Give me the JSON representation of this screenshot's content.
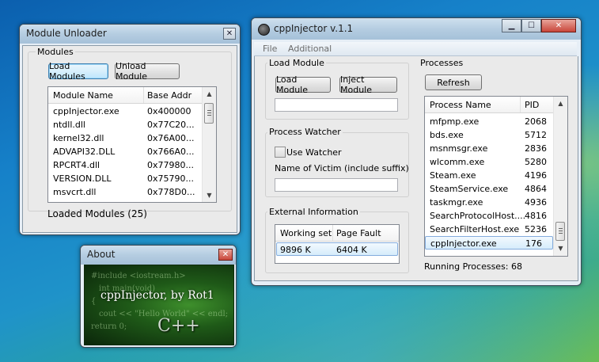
{
  "unloader": {
    "title": "Module Unloader",
    "group_label": "Modules",
    "load_btn": "Load Modules",
    "unload_btn": "Unload Module",
    "columns": [
      "Module Name",
      "Base Addr"
    ],
    "rows": [
      [
        "cppInjector.exe",
        "0x400000"
      ],
      [
        "ntdll.dll",
        "0x77C20..."
      ],
      [
        "kernel32.dll",
        "0x76A00..."
      ],
      [
        "ADVAPI32.DLL",
        "0x766A0..."
      ],
      [
        "RPCRT4.dll",
        "0x77980..."
      ],
      [
        "VERSION.DLL",
        "0x75790..."
      ],
      [
        "msvcrt.dll",
        "0x778D0..."
      ]
    ],
    "status": "Loaded Modules (25)"
  },
  "about": {
    "title": "About",
    "banner_text": "cppInjector, by Rot1",
    "bg_code": [
      "#include <iostream.h>",
      "int main(void)",
      "{",
      "cout << \"Hello World\" << endl;",
      "return 0;"
    ],
    "cpp_logo": "C++"
  },
  "injector": {
    "title": "cppInjector v.1.1",
    "menu": [
      "File",
      "Additional"
    ],
    "load_group": "Load Module",
    "load_btn": "Load Module",
    "inject_btn": "Inject Module",
    "load_path_value": "",
    "watcher_group": "Process Watcher",
    "use_watcher": "Use Watcher",
    "victim_label": "Name of Victim (include suffix)",
    "victim_value": "",
    "ext_group": "External Information",
    "ext_columns": [
      "Working set",
      "Page Fault"
    ],
    "ext_row": [
      "9896 K",
      "6404 K"
    ],
    "proc_group": "Processes",
    "refresh_btn": "Refresh",
    "proc_columns": [
      "Process Name",
      "PID"
    ],
    "processes": [
      [
        "mfpmp.exe",
        "2068"
      ],
      [
        "bds.exe",
        "5712"
      ],
      [
        "msnmsgr.exe",
        "2836"
      ],
      [
        "wlcomm.exe",
        "5280"
      ],
      [
        "Steam.exe",
        "4196"
      ],
      [
        "SteamService.exe",
        "4864"
      ],
      [
        "taskmgr.exe",
        "4936"
      ],
      [
        "SearchProtocolHost....",
        "4816"
      ],
      [
        "SearchFilterHost.exe",
        "5236"
      ],
      [
        "cppInjector.exe",
        "176"
      ]
    ],
    "running": "Running Processes: 68"
  },
  "icons": {
    "close": "close-icon",
    "minimize": "minimize-icon",
    "maximize": "maximize-icon",
    "app": "app-icon"
  }
}
